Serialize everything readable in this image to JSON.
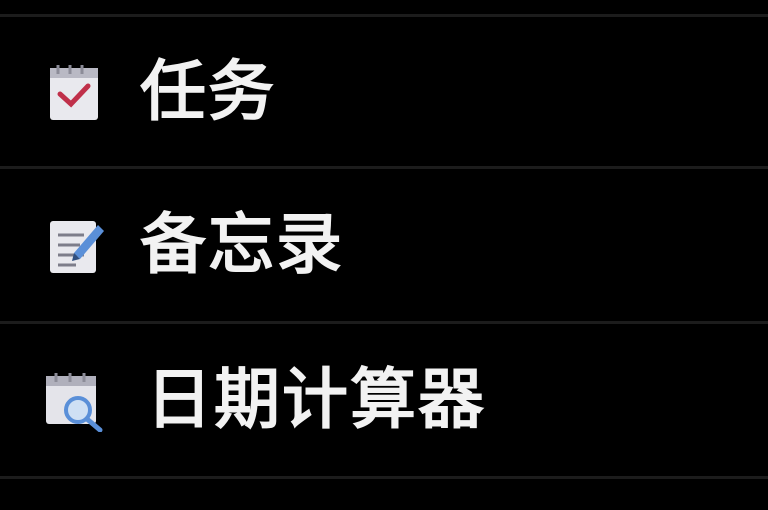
{
  "menu": {
    "items": [
      {
        "label": "任务",
        "icon": "task-checklist-icon"
      },
      {
        "label": "备忘录",
        "icon": "memo-pen-icon"
      },
      {
        "label": "日期计算器",
        "icon": "date-calculator-magnifier-icon"
      }
    ]
  },
  "colors": {
    "background": "#000000",
    "text": "#f2f2f2",
    "divider": "#1c1c1c",
    "icon_accent_red": "#c0304a",
    "icon_accent_blue": "#5a8fd8"
  }
}
